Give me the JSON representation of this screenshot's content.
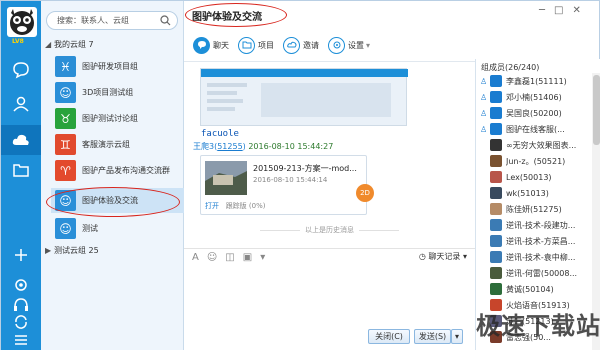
{
  "app": {
    "level_label": "LV8"
  },
  "rail": {
    "icons": [
      "chat-bubble-icon",
      "contacts-icon",
      "cloud-icon",
      "folder-icon",
      "plus-icon",
      "gear-icon",
      "earphone-icon",
      "sync-icon",
      "menu-icon"
    ]
  },
  "search": {
    "placeholder": "搜索：联系人、云组"
  },
  "groups": {
    "my_header": "我的云组 7",
    "items": [
      {
        "label": "图驴研发项目组",
        "color": "#2b8ed6",
        "glyph": "♓"
      },
      {
        "label": "3D项目测试组",
        "color": "#2a8fd8",
        "glyph": "☺"
      },
      {
        "label": "图驴测试讨论组",
        "color": "#28a33c",
        "glyph": "♉"
      },
      {
        "label": "客服演示云组",
        "color": "#e14a2e",
        "glyph": "♊"
      },
      {
        "label": "图驴产品发布沟通交流群",
        "color": "#e34a2d",
        "glyph": "♈"
      },
      {
        "label": "图驴体验及交流",
        "color": "#2a8fd8",
        "glyph": "☺"
      },
      {
        "label": "测试",
        "color": "#2a8fd8",
        "glyph": "☺"
      }
    ],
    "test_header": "测试云组 25"
  },
  "chat": {
    "title": "图驴体验及交流",
    "toolbar": {
      "chat": "聊天",
      "project": "项目",
      "invite": "邀请",
      "settings": "设置"
    },
    "mono_text": "facuole",
    "sender_prefix": "王爬3(",
    "sender_id": "51255",
    "sender_suffix": ")",
    "sender_time": "2016-08-10 15:44:27",
    "file_name": "201509-213-方案一-mod...",
    "file_time": "2016-08-10 15:44:14",
    "file_badge": "2D",
    "file_open": "打开",
    "file_trace": "跟踪版 (0%)",
    "history_text": "以上是历史消息",
    "history_button": "聊天记录",
    "close_btn": "关闭(C)",
    "send_btn": "发送(S)"
  },
  "members": {
    "header": "组成员(26/240)",
    "list": [
      {
        "name": "李鑫磊1(51111)",
        "color": "#1a7cd0",
        "role": true
      },
      {
        "name": "邓小楠(51406)",
        "color": "#1a7cd0",
        "role": true
      },
      {
        "name": "吴国良(50200)",
        "color": "#1a7cd0",
        "role": true
      },
      {
        "name": "图驴在线客服(...",
        "color": "#1a7cd0",
        "role": true
      },
      {
        "name": "∞无穷大效果图表...",
        "color": "#333333",
        "role": false
      },
      {
        "name": "Jun-z。(50521)",
        "color": "#7a5230",
        "role": false
      },
      {
        "name": "Lex(50013)",
        "color": "#b8554a",
        "role": false
      },
      {
        "name": "wk(51013)",
        "color": "#384a5e",
        "role": false
      },
      {
        "name": "陈佳妍(51275)",
        "color": "#b58b66",
        "role": false
      },
      {
        "name": "逆讯-技术-段建功...",
        "color": "#3b7bb4",
        "role": false
      },
      {
        "name": "逆讯-技术-方菜昌...",
        "color": "#3b7bb4",
        "role": false
      },
      {
        "name": "逆讯-技术-袁中柳...",
        "color": "#3b7bb4",
        "role": false
      },
      {
        "name": "逆讯-何雷(50008...",
        "color": "#4a5b3c",
        "role": false
      },
      {
        "name": "黄诚(50104)",
        "color": "#2d6d3a",
        "role": false
      },
      {
        "name": "火焰语音(51913)",
        "color": "#c7452b",
        "role": false
      },
      {
        "name": "苏三(51213)",
        "color": "#5a5a7a",
        "role": false
      },
      {
        "name": "雷志强(50...",
        "color": "#7a3b2a",
        "role": false
      }
    ]
  },
  "watermark": "极速下载站"
}
